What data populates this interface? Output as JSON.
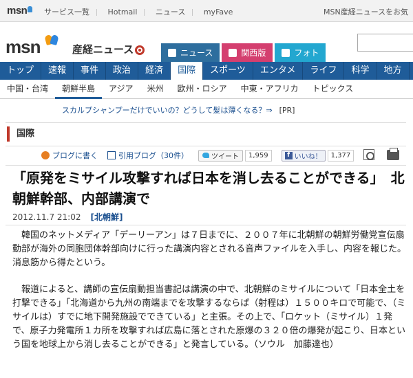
{
  "topbar": {
    "logo": "msn",
    "links": [
      "サービス一覧",
      "Hotmail",
      "ニュース",
      "myFave"
    ],
    "right_text": "MSN産経ニュースをお気"
  },
  "brand": {
    "logo_msn": "msn",
    "logo_sankei": "産経ニュース",
    "tabs": [
      "ニュース",
      "関西版",
      "フォト"
    ]
  },
  "main_nav": [
    "トップ",
    "速報",
    "事件",
    "政治",
    "経済",
    "国際",
    "スポーツ",
    "エンタメ",
    "ライフ",
    "科学",
    "地方"
  ],
  "main_nav_active": "国際",
  "sub_nav": [
    "中国・台湾",
    "朝鮮半島",
    "アジア",
    "米州",
    "欧州・ロシア",
    "中東・アフリカ",
    "トピックス"
  ],
  "sub_nav_active": "朝鮮半島",
  "promo": {
    "text": "スカルプシャンプーだけでいいの？どうして髪は薄くなる？⇒",
    "tag": "[PR]"
  },
  "section_title": "国際",
  "social": {
    "blog_write": "ブログに書く",
    "quote_blog": "引用ブログ（30件）",
    "tweet_label": "ツイート",
    "tweet_count": "1,959",
    "like_label": "いいね！",
    "like_count": "1,377"
  },
  "article": {
    "title": "「原発をミサイル攻撃すれば日本を消し去ることができる」　北朝鮮幹部、内部講演で",
    "date": "2012.11.7 21:02",
    "category": "[北朝鮮]",
    "paragraph1": "　韓国のネットメディア「デーリーアン」は７日までに、２００７年に北朝鮮の朝鮮労働党宣伝扇動部が海外の同胞団体幹部向けに行った講演内容とされる音声ファイルを入手し、内容を報じた。消息筋から得たという。",
    "paragraph2": "　報道によると、講師の宣伝扇動担当書記は講演の中で、北朝鮮のミサイルについて「日本全土を打撃できる」「北海道から九州の南端までを攻撃するならば（射程は）１５００キロで可能で、（ミサイルは）すでに地下開発施設でできている」と主張。その上で、「ロケット（ミサイル）１発で、原子力発電所１カ所を攻撃すれば広島に落とされた原爆の３２０倍の爆発が起こり、日本という国を地球上から消し去ることができる」と発言している。（ソウル　加藤達也）"
  },
  "colors": {
    "nav_blue": "#1f5c99",
    "section_red": "#c0392b",
    "tab_news": "#2e6e9e",
    "tab_kansai": "#d43f6f",
    "tab_photo": "#23a7d0"
  }
}
